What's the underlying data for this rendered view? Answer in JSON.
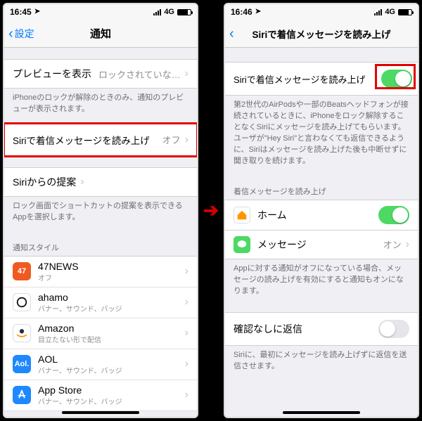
{
  "left": {
    "status": {
      "time": "16:45",
      "network": "4G"
    },
    "nav": {
      "back_label": "設定",
      "title": "通知"
    },
    "preview": {
      "label": "プレビューを表示",
      "value": "ロックされていな…"
    },
    "preview_footer": "iPhoneのロックが解除のときのみ、通知のプレビューが表示されます。",
    "siri_announce": {
      "label": "Siriで着信メッセージを読み上げ",
      "value": "オフ"
    },
    "siri_suggest": {
      "label": "Siriからの提案"
    },
    "siri_suggest_footer": "ロック画面でショートカットの提案を表示できるAppを選択します。",
    "style_header": "通知スタイル",
    "apps": [
      {
        "name": "47NEWS",
        "sub": "オフ",
        "icon": "47",
        "color": "ic-47"
      },
      {
        "name": "ahamo",
        "sub": "バナー、サウンド、バッジ",
        "icon": "ahamo",
        "color": "ic-ahamo"
      },
      {
        "name": "Amazon",
        "sub": "目立たない形で配信",
        "icon": "amazon",
        "color": "ic-amazon"
      },
      {
        "name": "AOL",
        "sub": "バナー、サウンド、バッジ",
        "icon": "Aol.",
        "color": "ic-aol"
      },
      {
        "name": "App Store",
        "sub": "バナー、サウンド、バッジ",
        "icon": "appstore",
        "color": "ic-appstore"
      }
    ]
  },
  "right": {
    "status": {
      "time": "16:46",
      "network": "4G"
    },
    "nav": {
      "title": "Siriで着信メッセージを読み上げ"
    },
    "master_toggle": {
      "label": "Siriで着信メッセージを読み上げ",
      "on": true
    },
    "master_footer": "第2世代のAirPodsや一部のBeatsヘッドフォンが接続されているときに、iPhoneをロック解除することなくSiriにメッセージを読み上げてもらいます。ユーザが\"Hey Siri\"と言わなくても返信できるように、Siriはメッセージを読み上げた後も中断せずに聞き取りを続けます。",
    "apps_header": "着信メッセージを読み上げ",
    "apps": {
      "home": {
        "label": "ホーム",
        "on": true
      },
      "messages": {
        "label": "メッセージ",
        "value": "オン"
      }
    },
    "apps_footer": "Appに対する通知がオフになっている場合、メッセージの読み上げを有効にすると通知もオンになります。",
    "confirm": {
      "label": "確認なしに返信",
      "on": false
    },
    "confirm_footer": "Siriに、最初にメッセージを読み上げずに返信を送信させます。"
  }
}
